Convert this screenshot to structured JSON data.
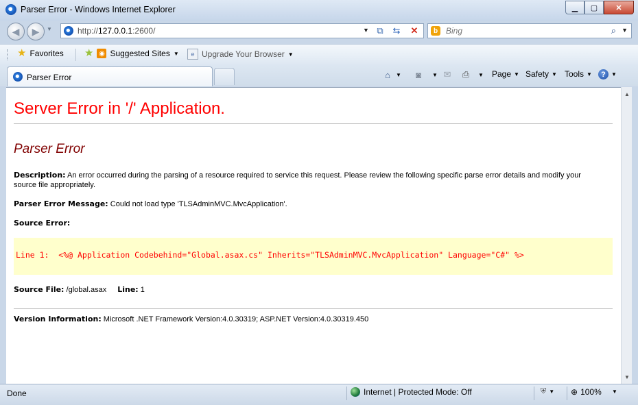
{
  "window": {
    "title": "Parser Error - Windows Internet Explorer",
    "icon": "ie-icon"
  },
  "nav": {
    "back_icon": "back-arrow-icon",
    "forward_icon": "forward-arrow-icon",
    "url_prefix": "http://",
    "url_host": "127.0.0.1",
    "url_rest": ":2600/",
    "search_placeholder": "Bing"
  },
  "favorites": {
    "favorites_label": "Favorites",
    "suggested_label": "Suggested Sites",
    "upgrade_label": "Upgrade Your Browser"
  },
  "tabs": [
    {
      "label": "Parser Error"
    }
  ],
  "commands": {
    "page": "Page",
    "safety": "Safety",
    "tools": "Tools"
  },
  "page": {
    "heading": "Server Error in '/' Application.",
    "subheading": "Parser Error",
    "description_label": "Description:",
    "description_text": " An error occurred during the parsing of a resource required to service this request. Please review the following specific parse error details and modify your source file appropriately.",
    "message_label": "Parser Error Message:",
    "message_text": " Could not load type 'TLSAdminMVC.MvcApplication'.",
    "source_error_label": "Source Error:",
    "source_line": "Line 1:  <%@ Application Codebehind=\"Global.asax.cs\" Inherits=\"TLSAdminMVC.MvcApplication\" Language=\"C#\" %>",
    "source_file_label": "Source File:",
    "source_file_value": " /global.asax",
    "line_label": "Line:",
    "line_value": " 1",
    "version_label": "Version Information:",
    "version_text": " Microsoft .NET Framework Version:4.0.30319; ASP.NET Version:4.0.30319.450"
  },
  "status": {
    "text": "Done",
    "zone": "Internet | Protected Mode: Off",
    "zoom": "100%"
  },
  "colors": {
    "heading": "#ff0000",
    "subheading": "#800000",
    "code_bg": "#ffffcc",
    "code_text": "#ff0000"
  }
}
